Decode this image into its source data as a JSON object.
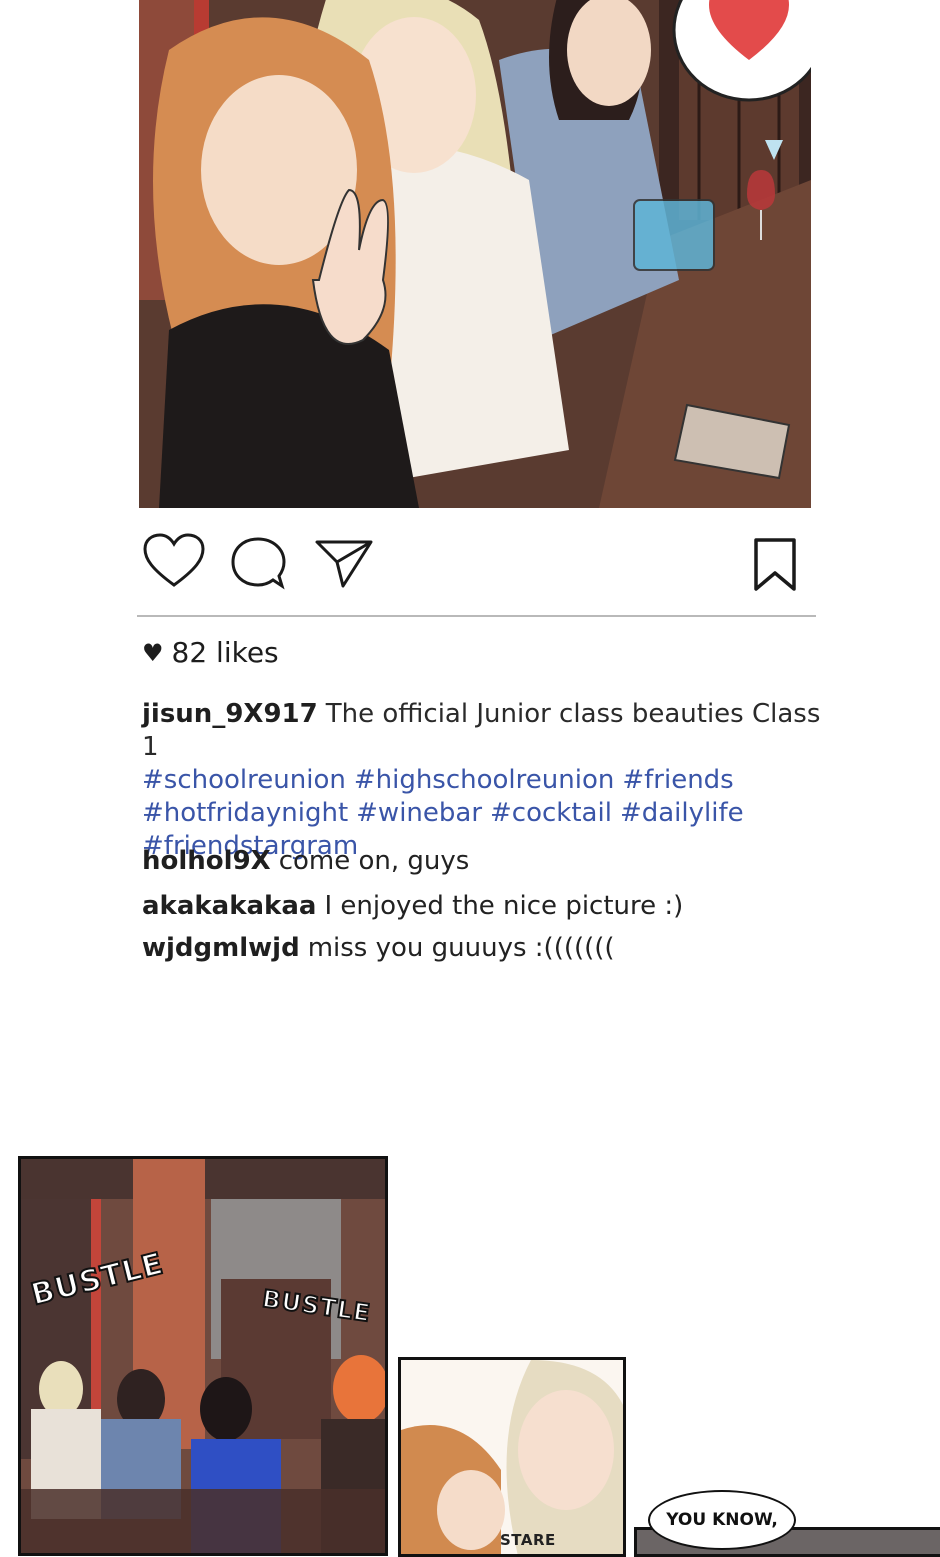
{
  "post": {
    "likes_count": "82 likes",
    "author": "jisun_9X917",
    "caption": "The official Junior class beauties Class 1",
    "hashtags": [
      "#schoolreunion",
      "#highschoolreunion",
      "#friends",
      "#hotfridaynight",
      "#winebar",
      "#cocktail",
      "#dailylife",
      "#friendstargram"
    ],
    "comments": [
      {
        "user": "holhol9X",
        "text": "come on, guys"
      },
      {
        "user": "akakakakaa",
        "text": "I enjoyed the nice picture :)"
      },
      {
        "user": "wjdgmlwjd",
        "text": "miss you guuuys :((((((("
      }
    ],
    "icons": {
      "like": "heart-outline-icon",
      "comment": "speech-bubble-icon",
      "share": "paper-plane-icon",
      "save": "bookmark-icon",
      "likes_heart": "heart-filled-icon"
    },
    "colors": {
      "hashtag": "#3a55a8",
      "divider": "#b9b9b9"
    }
  },
  "panels": {
    "sfx_bustle_1": "BUSTLE",
    "sfx_bustle_2": "BUSTLE",
    "sfx_stare": "STARE",
    "speech": "YOU KNOW,"
  }
}
